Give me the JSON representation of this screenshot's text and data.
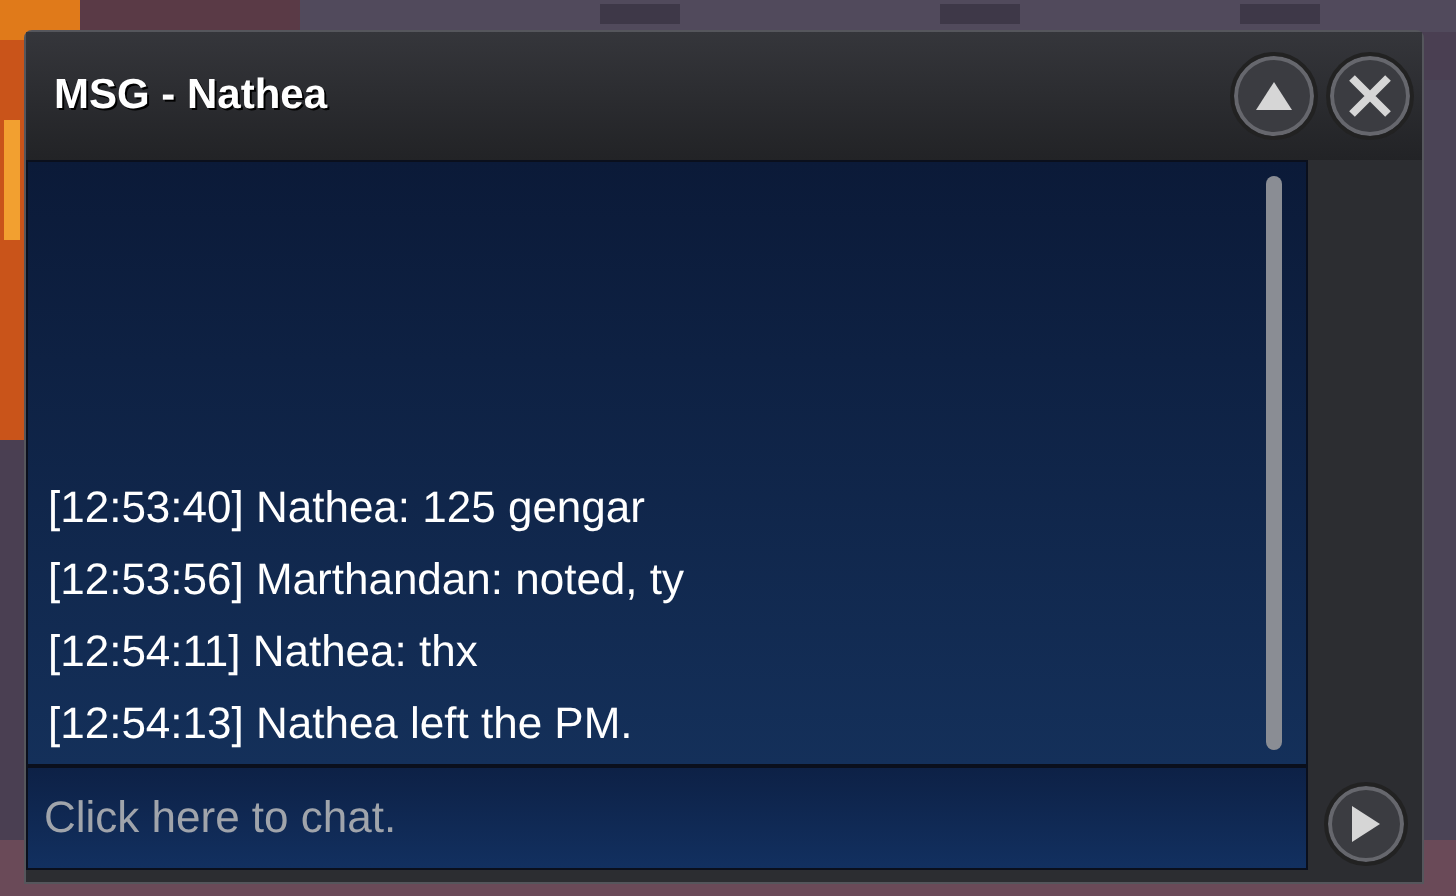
{
  "window": {
    "title": "MSG - Nathea"
  },
  "messages": [
    {
      "text": "[12:53:40] Nathea: 125 gengar"
    },
    {
      "text": "[12:53:56] Marthandan: noted, ty"
    },
    {
      "text": "[12:54:11] Nathea: thx"
    },
    {
      "text": "[12:54:13] Nathea left the PM."
    }
  ],
  "chat_input": {
    "placeholder": "Click here to chat."
  }
}
